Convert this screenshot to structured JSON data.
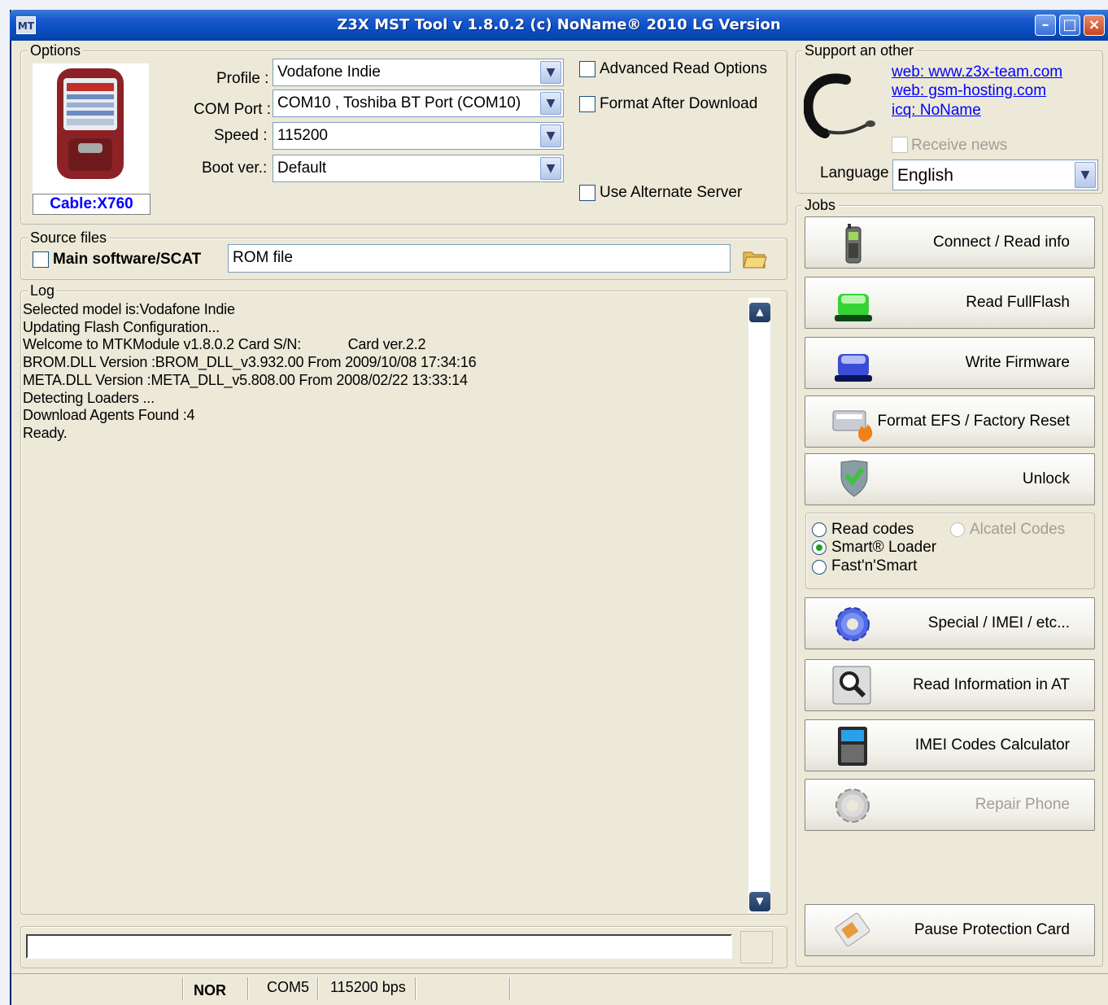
{
  "window": {
    "title": "Z3X MST Tool v 1.8.0.2 (c) NoName® 2010 LG Version",
    "icon_label": "MT"
  },
  "options": {
    "legend": "Options",
    "cable_label": "Cable:X760",
    "profile_label": "Profile :",
    "profile_value": "Vodafone Indie",
    "com_label": "COM Port :",
    "com_value": "COM10 , Toshiba BT Port (COM10)",
    "speed_label": "Speed :",
    "speed_value": "115200",
    "boot_label": "Boot ver.:",
    "boot_value": "Default",
    "adv_read": "Advanced Read Options",
    "format_after": "Format After Download",
    "alt_server": "Use Alternate Server"
  },
  "support": {
    "legend": "Support an other",
    "link1": "web: www.z3x-team.com",
    "link2": "web: gsm-hosting.com",
    "link3": "icq: NoName",
    "receive_news": "Receive news",
    "language_label": "Language",
    "language_value": "English"
  },
  "source": {
    "legend": "Source files",
    "main_label": "Main software/SCAT",
    "rom_value": "ROM file"
  },
  "log": {
    "legend": "Log",
    "lines": [
      "Selected model is:Vodafone Indie",
      "Updating Flash Configuration...",
      "Welcome to MTKModule v1.8.0.2 Card S/N:            Card ver.2.2",
      "BROM.DLL Version :BROM_DLL_v3.932.00 From 2009/10/08 17:34:16",
      "META.DLL Version :META_DLL_v5.808.00 From 2008/02/22 13:33:14",
      "Detecting Loaders ...",
      "Download Agents Found :4",
      "Ready."
    ]
  },
  "jobs": {
    "legend": "Jobs",
    "connect": "Connect / Read info",
    "read_fullflash": "Read FullFlash",
    "write_firmware": "Write Firmware",
    "format_efs": "Format EFS / Factory Reset",
    "unlock": "Unlock",
    "radio_read_codes": "Read codes",
    "radio_alcatel": "Alcatel Codes",
    "radio_smart": "Smart® Loader",
    "radio_fast": "Fast'n'Smart",
    "special": "Special / IMEI / etc...",
    "read_info_at": "Read Information in AT",
    "imei_calc": "IMEI Codes Calculator",
    "repair_phone": "Repair Phone",
    "pause_card": "Pause Protection Card"
  },
  "status": {
    "mode": "NOR",
    "port": "COM5",
    "baud": "115200 bps"
  },
  "colors": {
    "title_bar": "#0a4fc4",
    "window_bg": "#ece9d8",
    "link": "#0000ff",
    "cable_text": "#0000ff"
  }
}
